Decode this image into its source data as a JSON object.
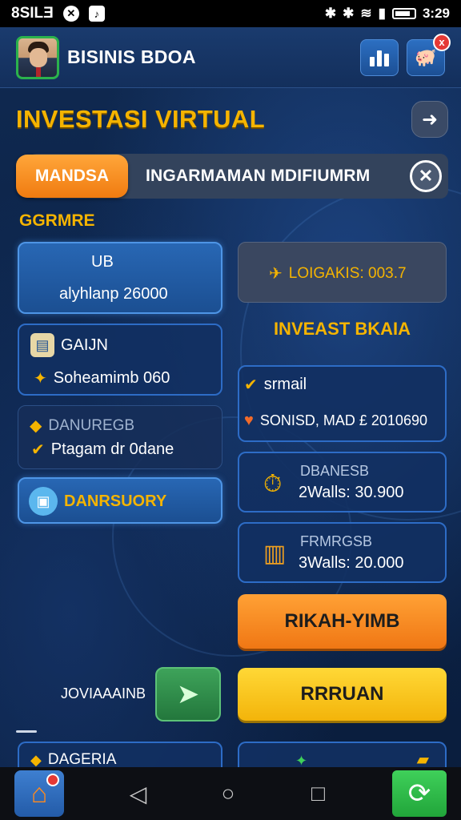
{
  "status_bar": {
    "carrier": "8SILƎ",
    "time": "3:29"
  },
  "header": {
    "title": "BISINIS BDOA"
  },
  "page": {
    "title": "INVESTASI VIRTUAL"
  },
  "tabs": {
    "active": "MANDSA",
    "subtitle": "INGARMAMAN MDIFIUMRM"
  },
  "section_label": "GGRMRE",
  "left_cards": [
    {
      "line1": "UB",
      "line2": "alyhlanp 26000"
    },
    {
      "line1": "GAIJN",
      "line2": "Soheamimb 060"
    },
    {
      "line1": "DANUREGB",
      "line2": "Ptagam dr 0dane"
    },
    {
      "line1": "DANRSUORY"
    }
  ],
  "right": {
    "gray_card": "LOIGAKIS: 003.7",
    "section_title": "INVEAST BKAIA",
    "list_card": {
      "item1": "srmail",
      "item2": "SONISD, MAD £ 2010690"
    },
    "offer1": {
      "name": "DBANESB",
      "value": "2Walls: 30.900"
    },
    "offer2": {
      "name": "FRMRGSB",
      "value": "3Walls: 20.000"
    },
    "primary_button": "RIKAH-YIMB",
    "secondary_button": "RRRUAN"
  },
  "side_label": "JOVIAAAINB",
  "bottom_peek": "DAGERIA",
  "colors": {
    "accent_orange": "#f5b400",
    "card_blue": "#2867b4",
    "button_orange": "#f07714",
    "button_yellow": "#f3b40a",
    "button_green": "#2e8b47"
  }
}
